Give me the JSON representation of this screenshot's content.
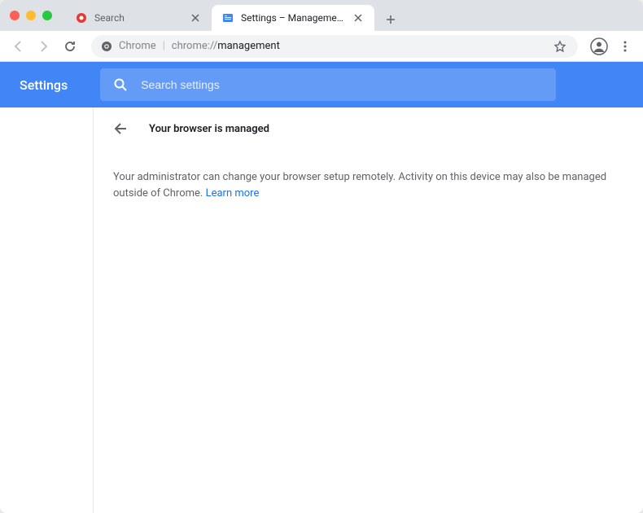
{
  "tabs": [
    {
      "title": "Search",
      "favicon_color": "#e53935"
    },
    {
      "title": "Settings – Management",
      "favicon_color": "#4285f4"
    }
  ],
  "address": {
    "scheme_label": "Chrome",
    "domain": "chrome://",
    "path": "management"
  },
  "settings": {
    "title": "Settings",
    "search_placeholder": "Search settings"
  },
  "page": {
    "heading": "Your browser is managed",
    "body": "Your administrator can change your browser setup remotely. Activity on this device may also be managed outside of Chrome. ",
    "learn_more": "Learn more"
  }
}
